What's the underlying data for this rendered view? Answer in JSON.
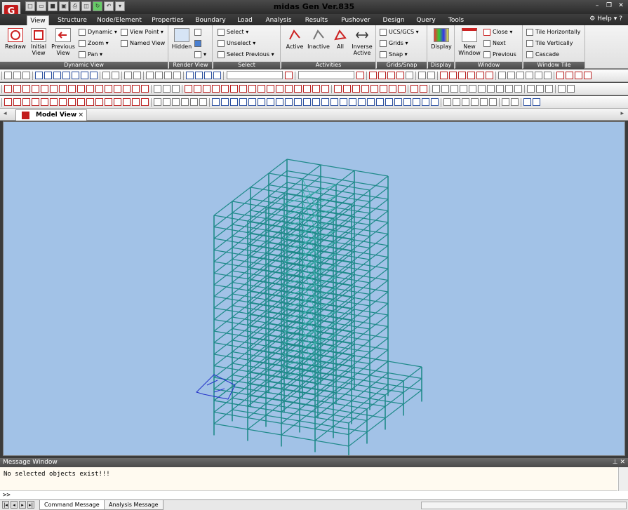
{
  "app": {
    "title": "midas Gen Ver.835",
    "logo_letter": "G",
    "quick_access_icons": [
      "new-file-icon",
      "open-folder-icon",
      "save-icon",
      "save-as-icon",
      "print-icon",
      "print-preview-icon",
      "refresh-icon",
      "dropdown-icon"
    ]
  },
  "window_controls": [
    "minimize",
    "restore",
    "close"
  ],
  "ribbon_tabs": [
    "View",
    "Structure",
    "Node/Element",
    "Properties",
    "Boundary",
    "Load",
    "Analysis",
    "Results",
    "Pushover",
    "Design",
    "Query",
    "Tools"
  ],
  "help_label": "Help",
  "ribbon": {
    "dynamic_view": {
      "label": "Dynamic View",
      "redraw": "Redraw",
      "initial": "Initial\nView",
      "previous": "Previous\nView",
      "dynamic": "Dynamic",
      "zoom": "Zoom",
      "pan": "Pan",
      "view_point": "View Point",
      "named_view": "Named View"
    },
    "render_view": {
      "label": "Render View",
      "hidden": "Hidden"
    },
    "select": {
      "label": "Select",
      "select": "Select",
      "unselect": "Unselect",
      "select_previous": "Select Previous"
    },
    "activities": {
      "label": "Activities",
      "active": "Active",
      "inactive": "Inactive",
      "all": "All",
      "inverse_active": "Inverse\nActive"
    },
    "grids_snap": {
      "label": "Grids/Snap",
      "ucs": "UCS/GCS",
      "grids": "Grids",
      "snap": "Snap"
    },
    "display": {
      "label": "Display",
      "display": "Display"
    },
    "window": {
      "label": "Window",
      "new_window": "New\nWindow",
      "close": "Close",
      "next": "Next",
      "previous": "Previous"
    },
    "window_tile": {
      "label": "Window Tile",
      "tile_h": "Tile Horizontally",
      "tile_v": "Tile Vertically",
      "cascade": "Cascade"
    }
  },
  "doc_tab": {
    "label": "Model View",
    "close": "×"
  },
  "message_window": {
    "title": "Message Window",
    "message": "No selected objects exist!!!",
    "prompt": ">>",
    "tabs": [
      "Command Message",
      "Analysis Message"
    ]
  },
  "colors": {
    "viewport_bg": "#a2c2e7",
    "frame": "#1f8a8a",
    "frame_light": "#3fb3b0",
    "selection_blue": "#2331c8"
  }
}
